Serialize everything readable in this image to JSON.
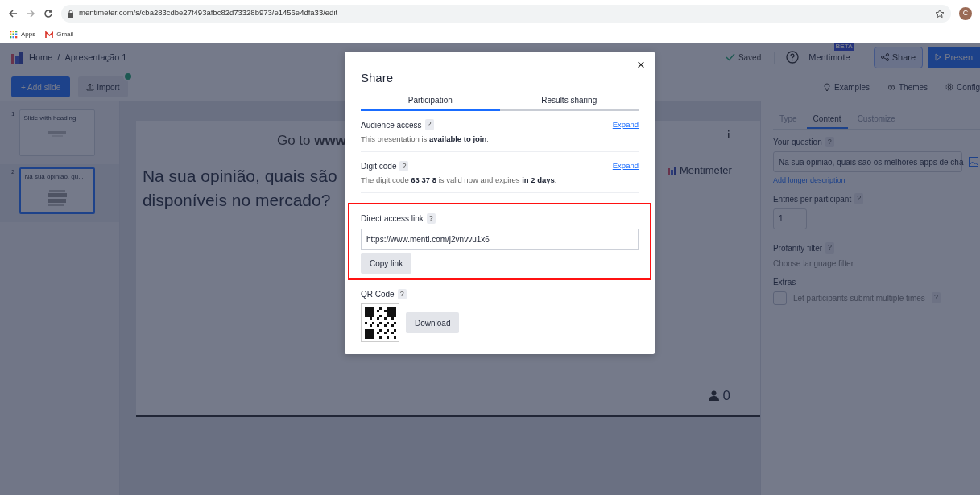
{
  "browser": {
    "url": "mentimeter.com/s/cba283cdbe27f493afbc82d73328b973/e1456e4dfa33/edit",
    "avatar": "C",
    "bookmarks": [
      {
        "label": "Apps"
      },
      {
        "label": "Gmail"
      }
    ]
  },
  "header": {
    "home": "Home",
    "separator": "/",
    "title": "Apresentação 1",
    "saved": "Saved",
    "mentimote": "Mentimote",
    "beta": "BETA",
    "share": "Share",
    "present": "Presen"
  },
  "toolbar": {
    "add_slide": "+ Add slide",
    "import": "Import",
    "links": [
      {
        "label": "Examples"
      },
      {
        "label": "Themes"
      },
      {
        "label": "Config"
      }
    ]
  },
  "slides": [
    {
      "number": "1",
      "title": "Slide with heading",
      "kind": "heading",
      "selected": false
    },
    {
      "number": "2",
      "title": "Na sua opinião, qu...",
      "kind": "wordcloud",
      "selected": true
    }
  ],
  "slide": {
    "join": "Go to **www**",
    "question_lines": [
      "Na sua opinião, quais são",
      "disponíveis no mercado?"
    ],
    "brand": "Mentimeter",
    "participants": "0"
  },
  "editor": {
    "tabs": [
      {
        "label": "Type",
        "selected": false
      },
      {
        "label": "Content",
        "selected": true
      },
      {
        "label": "Customize",
        "selected": false
      }
    ],
    "question": {
      "label": "Your question",
      "help": "?",
      "value": "Na sua opinião, quais são os melhores apps de cha"
    },
    "add_description": "Add longer description",
    "entries": {
      "label": "Entries per participant",
      "help": "?",
      "value": "1"
    },
    "profanity": {
      "label": "Profanity filter",
      "help": "?",
      "value": "Choose language filter"
    },
    "extras_label": "Extras",
    "extras": [
      {
        "label": "Let participants submit multiple times",
        "help": "?",
        "checked": false
      }
    ]
  },
  "modal": {
    "title": "Share",
    "close": "×",
    "tabs": [
      {
        "label": "Participation",
        "selected": true
      },
      {
        "label": "Results sharing",
        "selected": false
      }
    ],
    "sections": [
      {
        "kind": "info",
        "title": "Audience access",
        "help": "?",
        "text": "This presentation is **available to join**.",
        "action": "Expand"
      },
      {
        "kind": "info",
        "title": "Digit code",
        "help": "?",
        "text": "The digit code **63 37 8** is valid now and expires **in 2 days**.",
        "action": "Expand"
      },
      {
        "kind": "link",
        "title": "Direct access link",
        "help": "?",
        "value": "https://www.menti.com/j2vnvvu1x6",
        "button": "Copy link",
        "highlighted": true
      },
      {
        "kind": "qr",
        "title": "QR Code",
        "help": "?",
        "button": "Download"
      }
    ]
  }
}
